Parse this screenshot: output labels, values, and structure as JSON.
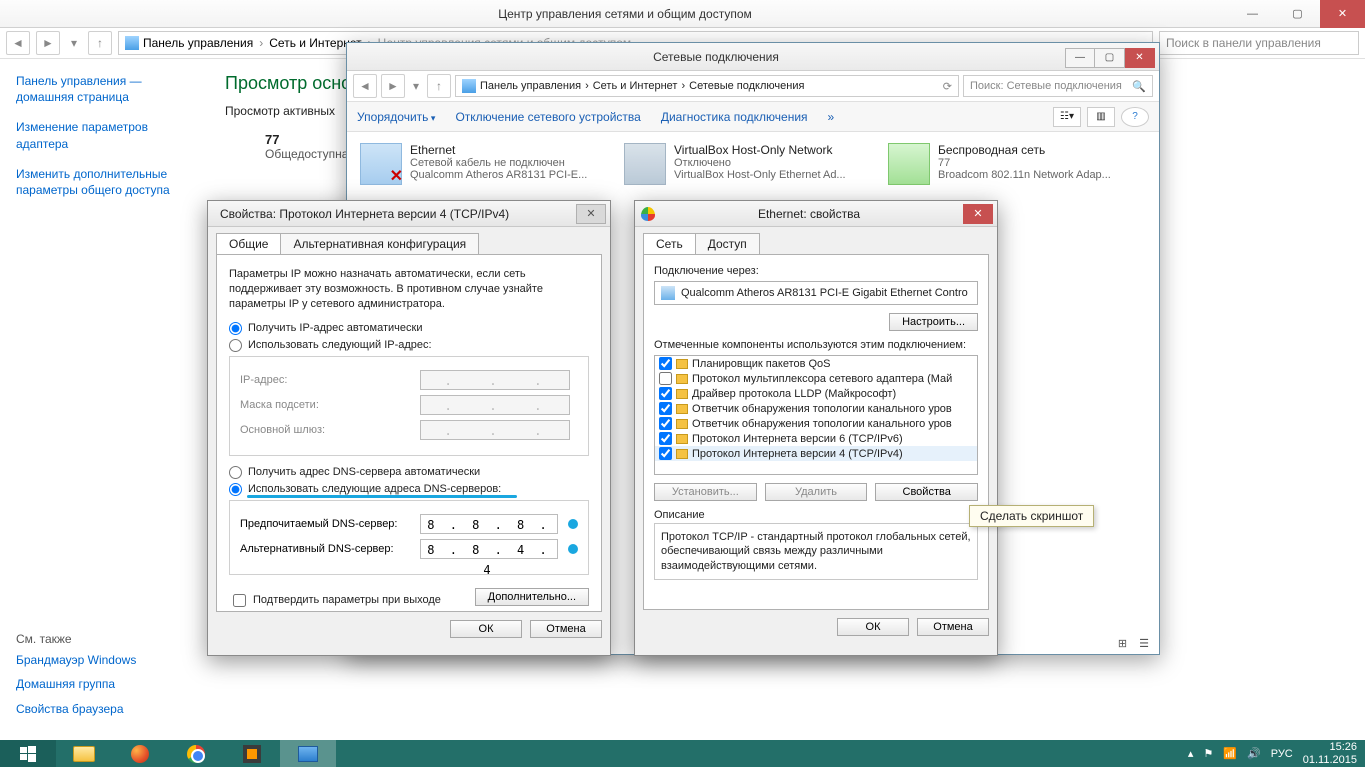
{
  "bg": {
    "title": "Центр управления сетями и общим доступом",
    "breadcrumb": [
      "Панель управления",
      "Сеть и Интернет",
      "Центр управления сетями и общим доступом"
    ],
    "search_ph": "Поиск в панели управления",
    "side": {
      "home": "Панель управления — домашняя страница",
      "link1": "Изменение параметров адаптера",
      "link2": "Изменить дополнительные параметры общего доступа",
      "also": "См. также",
      "also1": "Брандмауэр Windows",
      "also2": "Домашняя группа",
      "also3": "Свойства браузера"
    },
    "main": {
      "head": "Просмотр осно",
      "sub": "Просмотр активных",
      "nn": "77",
      "nt": "Общедоступная"
    }
  },
  "nc": {
    "title": "Сетевые подключения",
    "breadcrumb": [
      "Панель управления",
      "Сеть и Интернет",
      "Сетевые подключения"
    ],
    "search_ph": "Поиск: Сетевые подключения",
    "tools": {
      "org": "Упорядочить",
      "disable": "Отключение сетевого устройства",
      "diag": "Диагностика подключения"
    },
    "items": [
      {
        "name": "Ethernet",
        "status": "Сетевой кабель не подключен",
        "dev": "Qualcomm Atheros AR8131 PCI-E...",
        "kind": "eth"
      },
      {
        "name": "VirtualBox Host-Only Network",
        "status": "Отключено",
        "dev": "VirtualBox Host-Only Ethernet Ad...",
        "kind": "eth2"
      },
      {
        "name": "Беспроводная сеть",
        "status": "77",
        "dev": "Broadcom 802.11n Network Adap...",
        "kind": "wifi"
      }
    ]
  },
  "ep": {
    "title": "Ethernet: свойства",
    "tab_net": "Сеть",
    "tab_access": "Доступ",
    "connect_via": "Подключение через:",
    "device": "Qualcomm Atheros AR8131 PCI-E Gigabit Ethernet Contro",
    "configure_btn": "Настроить...",
    "components_label": "Отмеченные компоненты используются этим подключением:",
    "components": [
      {
        "checked": true,
        "label": "Планировщик пакетов QoS"
      },
      {
        "checked": false,
        "label": "Протокол мультиплексора сетевого адаптера (Май"
      },
      {
        "checked": true,
        "label": "Драйвер протокола LLDP (Майкрософт)"
      },
      {
        "checked": true,
        "label": "Ответчик обнаружения топологии канального уров"
      },
      {
        "checked": true,
        "label": "Ответчик обнаружения топологии канального уров"
      },
      {
        "checked": true,
        "label": "Протокол Интернета версии 6 (TCP/IPv6)"
      },
      {
        "checked": true,
        "label": "Протокол Интернета версии 4 (TCP/IPv4)"
      }
    ],
    "install": "Установить...",
    "uninstall": "Удалить",
    "props": "Свойства",
    "desc_title": "Описание",
    "desc": "Протокол TCP/IP - стандартный протокол глобальных сетей, обеспечивающий связь между различными взаимодействующими сетями.",
    "ok": "ОК",
    "cancel": "Отмена"
  },
  "ip": {
    "title": "Свойства: Протокол Интернета версии 4 (TCP/IPv4)",
    "tab_general": "Общие",
    "tab_alt": "Альтернативная конфигурация",
    "intro": "Параметры IP можно назначать автоматически, если сеть поддерживает эту возможность. В противном случае узнайте параметры IP у сетевого администратора.",
    "auto_ip": "Получить IP-адрес автоматически",
    "manual_ip": "Использовать следующий IP-адрес:",
    "f_ip": "IP-адрес:",
    "f_mask": "Маска подсети:",
    "f_gw": "Основной шлюз:",
    "auto_dns": "Получить адрес DNS-сервера автоматически",
    "manual_dns": "Использовать следующие адреса DNS-серверов:",
    "f_dns1": "Предпочитаемый DNS-сервер:",
    "f_dns2": "Альтернативный DNS-сервер:",
    "dns1": "8 . 8 . 8 . 8",
    "dns2": "8 . 8 . 4 . 4",
    "validate": "Подтвердить параметры при выходе",
    "advanced": "Дополнительно...",
    "ok": "ОК",
    "cancel": "Отмена"
  },
  "tooltip": "Сделать скриншот",
  "taskbar": {
    "lang": "РУС",
    "time": "15:26",
    "date": "01.11.2015"
  }
}
